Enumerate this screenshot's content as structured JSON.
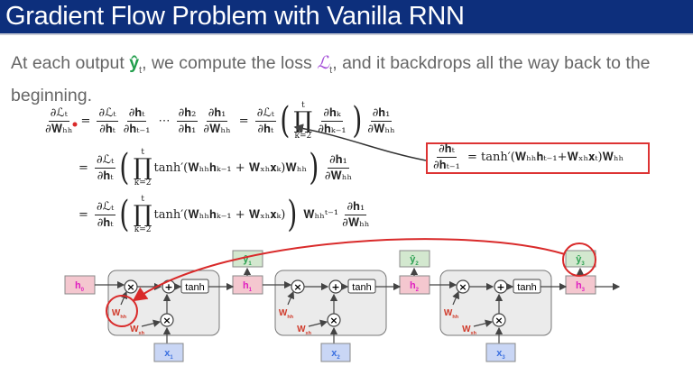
{
  "title": "Gradient Flow Problem with Vanilla RNN",
  "intro": {
    "before": "At each output ",
    "yhat": "ŷ",
    "yhat_sub": "t",
    "middle": ", we compute the loss ",
    "loss": "ℒ",
    "loss_sub": "t",
    "after": ", and it backdrops all the way back to the beginning."
  },
  "equations": [
    [
      {
        "t": "frac",
        "n": "∂ℒₜ",
        "d": "∂𝐖ₕₕ"
      },
      {
        "t": "op",
        "v": "="
      },
      {
        "t": "frac",
        "n": "∂ℒₜ",
        "d": "∂𝐡ₜ"
      },
      {
        "t": "frac",
        "n": "∂𝐡ₜ",
        "d": "∂𝐡ₜ₋₁"
      },
      {
        "t": "op",
        "v": "⋯"
      },
      {
        "t": "frac",
        "n": "∂𝐡₂",
        "d": "∂𝐡₁"
      },
      {
        "t": "frac",
        "n": "∂𝐡₁",
        "d": "∂𝐖ₕₕ"
      },
      {
        "t": "op",
        "v": "="
      },
      {
        "t": "frac",
        "n": "∂ℒₜ",
        "d": "∂𝐡ₜ"
      },
      {
        "t": "paren",
        "v": "("
      },
      {
        "t": "prod",
        "up": "t",
        "low": "k=2"
      },
      {
        "t": "frac",
        "n": "∂𝐡ₖ",
        "d": "∂𝐡ₖ₋₁"
      },
      {
        "t": "paren",
        "v": ")"
      },
      {
        "t": "frac",
        "n": "∂𝐡₁",
        "d": "∂𝐖ₕₕ"
      }
    ],
    [
      {
        "t": "op",
        "v": "="
      },
      {
        "t": "frac",
        "n": "∂ℒₜ",
        "d": "∂𝐡ₜ"
      },
      {
        "t": "paren",
        "v": "("
      },
      {
        "t": "prod",
        "up": "t",
        "low": "k=2"
      },
      {
        "t": "text",
        "v": "tanh′(𝐖ₕₕ𝐡ₖ₋₁ + 𝐖ₓₕ𝐱ₖ)𝐖ₕₕ"
      },
      {
        "t": "paren",
        "v": ")"
      },
      {
        "t": "frac",
        "n": "∂𝐡₁",
        "d": "∂𝐖ₕₕ"
      }
    ],
    [
      {
        "t": "op",
        "v": "="
      },
      {
        "t": "frac",
        "n": "∂ℒₜ",
        "d": "∂𝐡ₜ"
      },
      {
        "t": "paren",
        "v": "("
      },
      {
        "t": "prod",
        "up": "t",
        "low": "k=2"
      },
      {
        "t": "text",
        "v": "tanh′(𝐖ₕₕ𝐡ₖ₋₁ + 𝐖ₓₕ𝐱ₖ)"
      },
      {
        "t": "paren",
        "v": ")"
      },
      {
        "t": "text",
        "v": " 𝐖ₕₕᵗ⁻¹"
      },
      {
        "t": "frac",
        "n": "∂𝐡₁",
        "d": "∂𝐖ₕₕ"
      }
    ]
  ],
  "highlight_equation": [
    {
      "t": "frac",
      "n": "∂𝐡ₜ",
      "d": "∂𝐡ₜ₋₁"
    },
    {
      "t": "text",
      "v": " = tanh′(𝐖ₕₕ𝐡ₜ₋₁+𝐖ₓₕ𝐱ₜ)𝐖ₕₕ"
    }
  ],
  "diagram": {
    "hidden": [
      {
        "m": "h",
        "s": "0"
      },
      {
        "m": "h",
        "s": "1"
      },
      {
        "m": "h",
        "s": "2"
      },
      {
        "m": "h",
        "s": "3"
      }
    ],
    "outputs": [
      {
        "m": "ŷ",
        "s": "1"
      },
      {
        "m": "ŷ",
        "s": "2"
      },
      {
        "m": "ŷ",
        "s": "3"
      }
    ],
    "inputs": [
      {
        "m": "x",
        "s": "1"
      },
      {
        "m": "x",
        "s": "2"
      },
      {
        "m": "x",
        "s": "3"
      }
    ],
    "tanh_label": "tanh",
    "times_symbol": "×",
    "plus_symbol": "+",
    "whh": {
      "m": "W",
      "s": "hh"
    },
    "wxh": {
      "m": "W",
      "s": "xh"
    }
  },
  "colors": {
    "title_bar": "#0d2f7c",
    "hidden_fill": "#f4c7cf",
    "hidden_text": "#e020c0",
    "output_fill": "#d3e8cf",
    "output_text": "#2aa050",
    "input_fill": "#c9d6f5",
    "input_text": "#3a6fe0",
    "weight_text": "#d03a2a",
    "highlight": "#d92a2a"
  }
}
